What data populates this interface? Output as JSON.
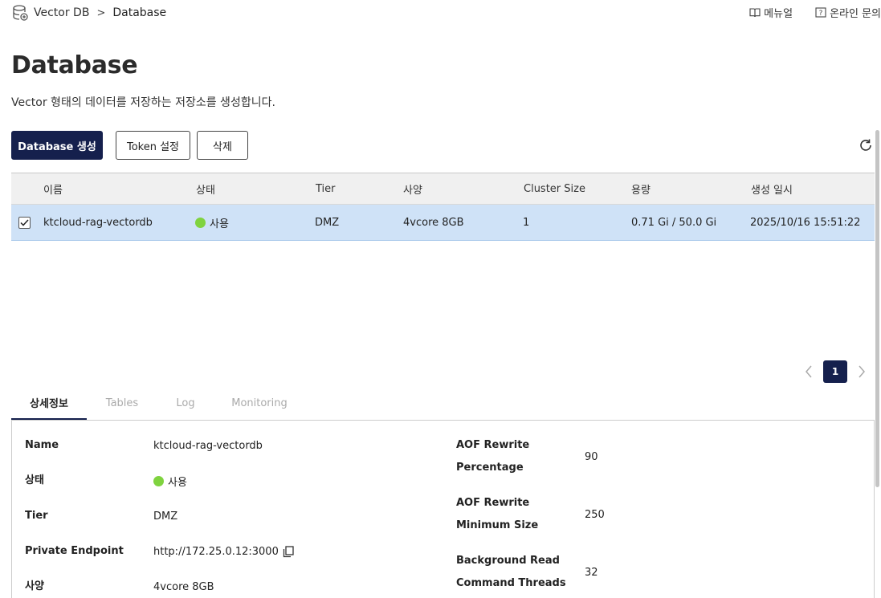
{
  "breadcrumb": {
    "root": "Vector DB",
    "separator": ">",
    "current": "Database"
  },
  "toplinks": {
    "manual": "메뉴얼",
    "inquiry": "온라인 문의"
  },
  "page": {
    "title": "Database",
    "description": "Vector 형태의 데이터를 저장하는 저장소를 생성합니다."
  },
  "toolbar": {
    "create": "Database 생성",
    "token": "Token 설정",
    "delete": "삭제"
  },
  "table": {
    "headers": [
      "이름",
      "상태",
      "Tier",
      "사양",
      "Cluster Size",
      "용량",
      "생성 일시"
    ],
    "rows": [
      {
        "name": "ktcloud-rag-vectordb",
        "status": "사용",
        "tier": "DMZ",
        "spec": "4vcore 8GB",
        "cluster_size": "1",
        "capacity": "0.71 Gi / 50.0 Gi",
        "created": "2025/10/16 15:51:22",
        "selected": true
      }
    ]
  },
  "pagination": {
    "current": "1"
  },
  "tabs": [
    "상세정보",
    "Tables",
    "Log",
    "Monitoring"
  ],
  "detail": {
    "left": [
      {
        "label": "Name",
        "value": "ktcloud-rag-vectordb"
      },
      {
        "label": "상태",
        "value": "사용"
      },
      {
        "label": "Tier",
        "value": "DMZ"
      },
      {
        "label": "Private Endpoint",
        "value": "http://172.25.0.12:3000"
      },
      {
        "label": "사양",
        "value": "4vcore 8GB"
      }
    ],
    "right": [
      {
        "label_line1": "AOF Rewrite",
        "label_line2": "Percentage",
        "value": "90"
      },
      {
        "label_line1": "AOF Rewrite",
        "label_line2": "Minimum Size",
        "value": "250"
      },
      {
        "label_line1": "Background Read",
        "label_line2": "Command Threads",
        "value": "32"
      }
    ]
  },
  "colors": {
    "primary": "#15204d",
    "status_active": "#7fd33f",
    "row_selected": "#cfe2f7"
  }
}
